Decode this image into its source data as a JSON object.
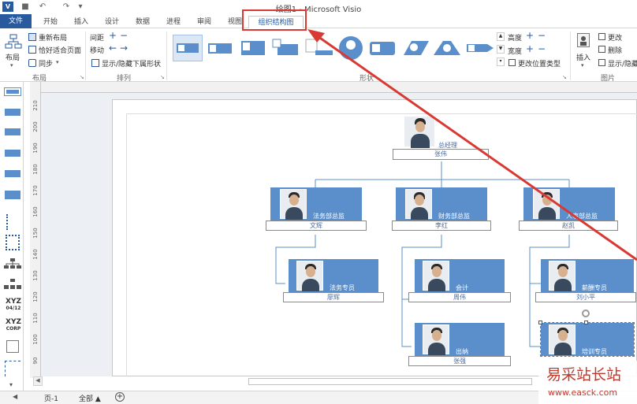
{
  "window": {
    "title": "绘图1 - Microsoft Visio"
  },
  "tabs": [
    {
      "label": "文件"
    },
    {
      "label": "开始"
    },
    {
      "label": "插入"
    },
    {
      "label": "设计"
    },
    {
      "label": "数据"
    },
    {
      "label": "进程"
    },
    {
      "label": "审阅"
    },
    {
      "label": "视图"
    },
    {
      "label": "组织结构图"
    }
  ],
  "ribbon": {
    "layout": {
      "big_button": "布局",
      "relayout": "重新布局",
      "fit_page": "恰好适合页面",
      "sync": "同步",
      "group_label": "布局"
    },
    "arrange": {
      "spacing": "间距",
      "move": "移动",
      "show_hide": "显示/隐藏下属形状",
      "group_label": "排列"
    },
    "shapes": {
      "group_label": "形状",
      "height": "高度",
      "width": "宽度",
      "change_position_type": "更改位置类型"
    },
    "picture": {
      "insert": "插入",
      "change": "更改",
      "delete": "删除",
      "show_hide": "显示/隐藏",
      "group_label": "图片"
    }
  },
  "ruler": {
    "vertical": [
      "210",
      "200",
      "190",
      "180",
      "170",
      "160",
      "150",
      "140",
      "130",
      "120",
      "110",
      "100",
      "90"
    ]
  },
  "stencil": {
    "xyz1": "XYZ",
    "xyz1_sub": "04/12",
    "xyz2": "XYZ",
    "xyz2_sub": "CORP"
  },
  "org": {
    "ceo": {
      "title": "总经理",
      "name": "张伟"
    },
    "legal_head": {
      "title": "法务部总监",
      "name": "文辉"
    },
    "finance_head": {
      "title": "财务部总监",
      "name": "李红"
    },
    "hr_head": {
      "title": "人事部总监",
      "name": "赵凯"
    },
    "legal_staff": {
      "title": "法务专员",
      "name": "廖辉"
    },
    "accountant": {
      "title": "会计",
      "name": "周伟"
    },
    "cashier": {
      "title": "出纳",
      "name": "张强"
    },
    "salary": {
      "title": "薪酬专员",
      "name": "刘小平"
    },
    "training": {
      "title": "培训专员",
      "name": ""
    }
  },
  "status": {
    "page_tab": "页-1",
    "all": "全部"
  },
  "watermark": {
    "site": "易采站长站",
    "url": "www.easck.com"
  },
  "colors": {
    "accent": "#2a5a9e",
    "card": "#5b8fcb",
    "highlight": "#d83a33"
  }
}
